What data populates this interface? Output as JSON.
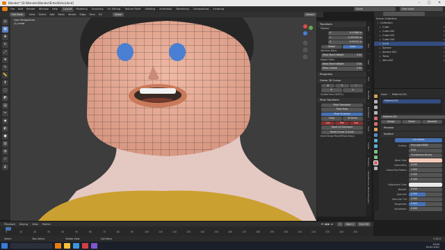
{
  "app": {
    "title": "Blender* [D:\\Blender\\Blender\\Ertes\\Kids.blend]"
  },
  "menu": [
    "File",
    "Edit",
    "Render",
    "Window",
    "Help"
  ],
  "workspaces": [
    "Layout",
    "Modeling",
    "Sculpting",
    "UV Editing",
    "Texture Paint",
    "Shading",
    "Animation",
    "Rendering",
    "Compositing",
    "Scripting"
  ],
  "active_workspace": "Layout",
  "scene": {
    "label": "Scene",
    "view_layer": "View Layer"
  },
  "viewport_header": {
    "mode": "Edit Mode",
    "items": [
      "View",
      "Select",
      "Add",
      "Mesh",
      "Vertex",
      "Edge",
      "Face",
      "UV"
    ],
    "transform": "Global",
    "options": "Options"
  },
  "viewport_info": {
    "view": "User Perspective",
    "object": "(1) head"
  },
  "toolbar": [
    "cursor",
    "move",
    "rotate",
    "scale",
    "transform",
    "annotate",
    "measure",
    "extrude",
    "inset",
    "bevel",
    "loopcut",
    "knife",
    "poly",
    "spin",
    "smooth",
    "edge-slide",
    "shrink",
    "shear",
    "rip"
  ],
  "npanel": {
    "transform_title": "Transform",
    "median_label": "Median:",
    "median": [
      {
        "axis": "X",
        "value": "0.12988 m"
      },
      {
        "axis": "Y",
        "value": "-0.031992 m"
      },
      {
        "axis": "Z",
        "value": "-0.54722 m"
      }
    ],
    "space_global": "Global",
    "space_local": "Local",
    "vertices_label": "Vertices Data:",
    "vertex_bevel": "Mean Bevel Weight",
    "vertex_bevel_val": "0.00",
    "edges_label": "Edges Data:",
    "edge_bevel": "Mean Bevel Weight",
    "edge_bevel_val": "0.00",
    "edge_crease": "Mean Crease",
    "edge_crease_val": "0.00",
    "properties_title": "Properties",
    "gizmo_title": "Gizmo 3D Cursor",
    "quaternion": "Quaternion (WXYZ)",
    "pivot_title": "Pivot Transform",
    "pivot_transform": "Pivot Transform",
    "pivot_drop": "Pivot Drop",
    "pivot_to_active": "Pivot To Active",
    "snap": "Snap",
    "snap_active": "To Active",
    "reset_axis": [
      "Loc",
      "Rot",
      "Sca"
    ],
    "reset_all": "Reset All Transform",
    "reset_cursor": "Reset Cursor & Scale",
    "dont_show": "Dont Show Panel(Pivot Drop)"
  },
  "vtabs": [
    "Item",
    "Tool",
    "View",
    "Edit",
    "BoolTool",
    "QuickTools",
    "Pivot",
    "Create",
    "HardOps",
    "MeshMachine",
    "Node Wrangler"
  ],
  "outliner": {
    "title": "Scene Collection",
    "search_placeholder": "",
    "collection": "Collection",
    "items": [
      {
        "name": "Cube",
        "selected": false
      },
      {
        "name": "Cube.002",
        "selected": false
      },
      {
        "name": "Cube.003",
        "selected": false
      },
      {
        "name": "Cube.004",
        "selected": false
      },
      {
        "name": "head",
        "selected": true
      },
      {
        "name": "Sphere",
        "selected": false
      },
      {
        "name": "Sphere.001",
        "selected": false
      },
      {
        "name": "Torus",
        "selected": false
      },
      {
        "name": "Vert.002",
        "selected": false
      }
    ]
  },
  "properties": {
    "object": "head",
    "material_slot": "Material.001",
    "material_list": "Material.001",
    "material_name": "Material.001",
    "buttons": [
      "Assign",
      "Select",
      "Deselect"
    ],
    "preview": "Preview",
    "surface_section": "Surface",
    "use_nodes": "Use Nodes",
    "surface_label": "Surface",
    "surface_value": "Principled BSDF",
    "ggx": "GGX",
    "sss": "Christensen-Burley",
    "rows": [
      {
        "k": "Base Color",
        "v": "",
        "color": "#f2c9b6"
      },
      {
        "k": "Subsurface",
        "v": "0.000"
      },
      {
        "k": "Subsurface Radius",
        "v": "1.000"
      },
      {
        "k": "",
        "v": "0.200"
      },
      {
        "k": "",
        "v": "0.100"
      },
      {
        "k": "Subsurface Color",
        "v": "",
        "color": "#e8e8e8"
      },
      {
        "k": "Metallic",
        "v": "0.000"
      },
      {
        "k": "Specular",
        "v": "0.500"
      },
      {
        "k": "Specular Tint",
        "v": "0.000"
      },
      {
        "k": "Roughness",
        "v": "0.500"
      },
      {
        "k": "Anisotropic",
        "v": "0.000"
      }
    ]
  },
  "timeline": {
    "items": [
      "Playback",
      "Keying",
      "View",
      "Marker"
    ],
    "frame": "1",
    "start_label": "Start",
    "start": "1",
    "end_label": "End",
    "end": "250",
    "ticks": [
      "0",
      "10",
      "20",
      "30",
      "40",
      "50",
      "60",
      "70",
      "80",
      "90",
      "100",
      "110",
      "120",
      "130",
      "140",
      "150",
      "160",
      "170",
      "180",
      "190",
      "200",
      "210",
      "220",
      "230",
      "240",
      "250"
    ]
  },
  "statusbar": {
    "select": "Select",
    "box": "Box Select",
    "rotate": "Rotate View",
    "call_menu": "Call Menu",
    "version": "2.92.0"
  },
  "taskbar": {
    "time": "13:05",
    "date": "05.02.2021"
  }
}
